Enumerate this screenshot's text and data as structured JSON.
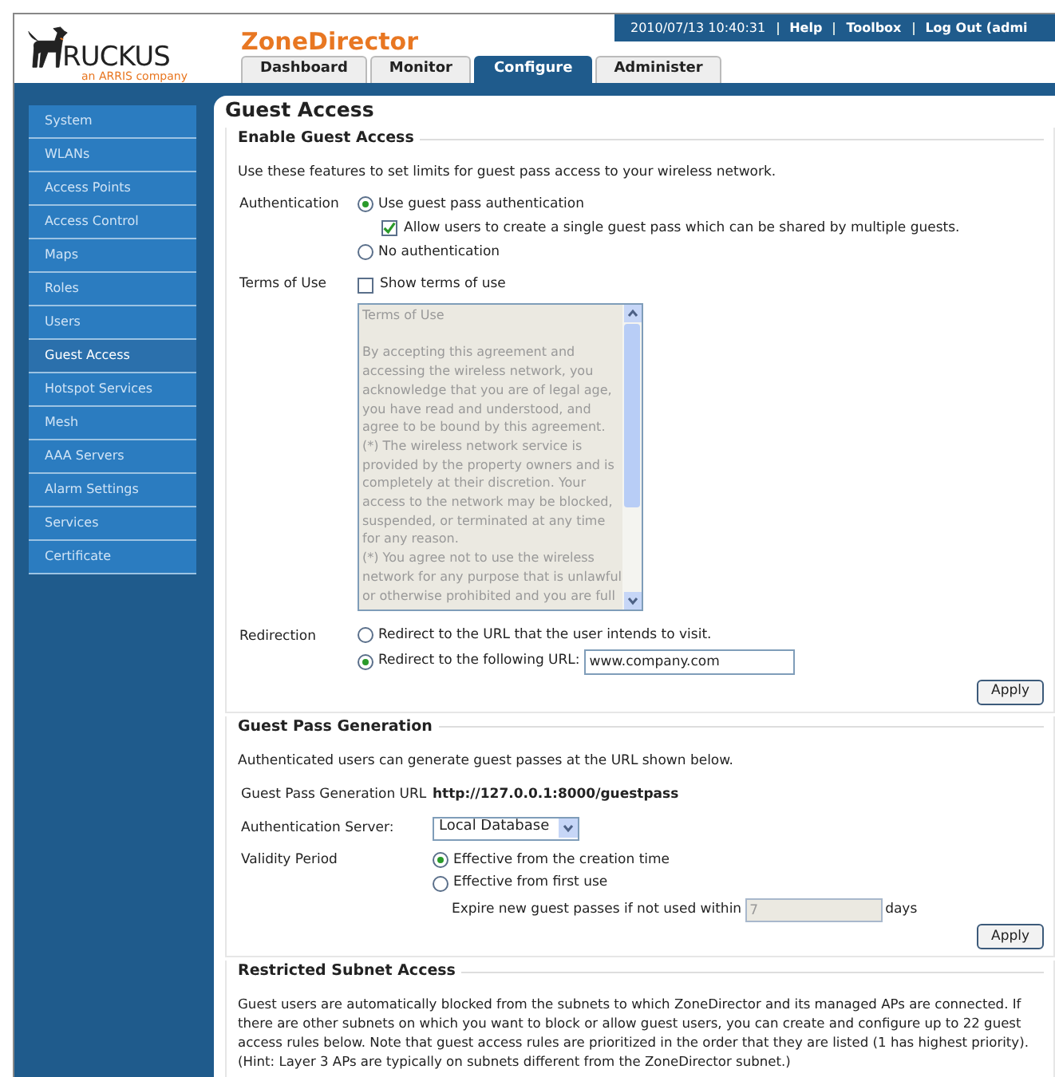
{
  "header": {
    "logo": {
      "name": "RUCKUS",
      "tagline": "an ARRIS company"
    },
    "product": "ZoneDirector",
    "status": {
      "datetime": "2010/07/13  10:40:31",
      "links": [
        "Help",
        "Toolbox",
        "Log Out (admi"
      ]
    }
  },
  "tabs": [
    {
      "label": "Dashboard",
      "selected": false
    },
    {
      "label": "Monitor",
      "selected": false
    },
    {
      "label": "Configure",
      "selected": true
    },
    {
      "label": "Administer",
      "selected": false
    }
  ],
  "sidebar": {
    "items": [
      {
        "label": "System",
        "selected": false
      },
      {
        "label": "WLANs",
        "selected": false
      },
      {
        "label": "Access Points",
        "selected": false
      },
      {
        "label": "Access Control",
        "selected": false
      },
      {
        "label": "Maps",
        "selected": false
      },
      {
        "label": "Roles",
        "selected": false
      },
      {
        "label": "Users",
        "selected": false
      },
      {
        "label": "Guest Access",
        "selected": true
      },
      {
        "label": "Hotspot Services",
        "selected": false
      },
      {
        "label": "Mesh",
        "selected": false
      },
      {
        "label": "AAA Servers",
        "selected": false
      },
      {
        "label": "Alarm Settings",
        "selected": false
      },
      {
        "label": "Services",
        "selected": false
      },
      {
        "label": "Certificate",
        "selected": false
      }
    ]
  },
  "page": {
    "title": "Guest Access",
    "enable_guest_access": {
      "legend": "Enable Guest Access",
      "intro": "Use these features to set limits for guest pass access to your wireless network.",
      "authentication": {
        "label": "Authentication",
        "options": [
          {
            "label": "Use guest pass authentication",
            "selected": true
          },
          {
            "label": "No authentication",
            "selected": false
          }
        ],
        "share_option": {
          "label": "Allow users to create a single guest pass which can be shared by multiple guests.",
          "checked": true
        }
      },
      "terms_of_use": {
        "label": "Terms of Use",
        "checkbox": {
          "label": "Show terms of use",
          "checked": false
        },
        "heading": "Terms of Use",
        "lines": [
          "By accepting this agreement and",
          "accessing the wireless network, you",
          "acknowledge that you are of legal age,",
          "you have read and understood, and",
          "agree to be bound by this agreement.",
          "(*) The wireless network service is",
          "provided by the property owners and is",
          "completely at their discretion. Your",
          "access to the network may be blocked,",
          "suspended, or terminated at any time",
          "for any reason.",
          "(*) You agree not to use the wireless",
          "network for any purpose that is unlawful",
          "or otherwise prohibited and you are full"
        ]
      },
      "redirection": {
        "label": "Redirection",
        "options": [
          {
            "label": "Redirect to the URL that the user intends to visit.",
            "selected": false
          },
          {
            "label": "Redirect to the following URL:",
            "selected": true
          }
        ],
        "url_value": "www.company.com"
      },
      "apply": "Apply"
    },
    "guest_pass_generation": {
      "legend": "Guest Pass Generation",
      "intro": "Authenticated users can generate guest passes at the URL shown below.",
      "url_label": "Guest Pass Generation URL",
      "url": "http://127.0.0.1:8000/guestpass",
      "server_label": "Authentication Server:",
      "server_value": "Local Database",
      "validity_label": "Validity Period",
      "options": [
        {
          "label": "Effective from the creation time",
          "selected": true
        },
        {
          "label": "Effective from first use",
          "selected": false
        }
      ],
      "expire_label": "Expire new guest passes if not used within",
      "expire_value": "7",
      "days": "days",
      "apply": "Apply"
    },
    "restricted_subnet_access": {
      "legend": "Restricted Subnet Access",
      "text": "Guest users are automatically blocked from the subnets to which ZoneDirector and its managed APs are connected. If there are other subnets on which you want to block or allow guest users, you can create and configure up to 22 guest access rules below. Note that guest access rules are prioritized in the order that they are listed (1 has highest priority). (Hint: Layer 3 APs are typically on subnets different from the ZoneDirector subnet.)"
    }
  }
}
